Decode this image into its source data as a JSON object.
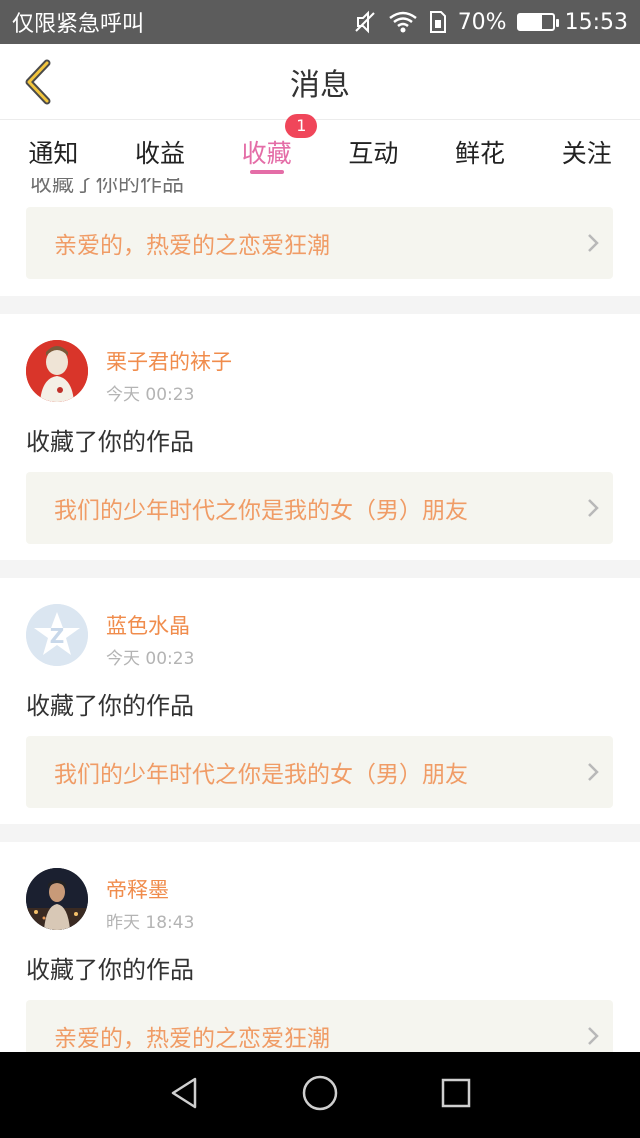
{
  "statusbar": {
    "carrier": "仅限紧急呼叫",
    "battery_percent": "70%",
    "battery_level": 0.7,
    "time": "15:53",
    "icons": [
      "mute-icon",
      "wifi-icon",
      "sim-icon",
      "battery-icon"
    ]
  },
  "header": {
    "title": "消息",
    "back_icon": "chevron-left-icon"
  },
  "tabs": [
    {
      "label": "通知"
    },
    {
      "label": "收益"
    },
    {
      "label": "收藏",
      "badge": "1",
      "active": true
    },
    {
      "label": "互动"
    },
    {
      "label": "鲜花"
    },
    {
      "label": "关注"
    }
  ],
  "feed": {
    "partial_top": {
      "text": "收藏了你的作品",
      "work": "亲爱的，热爱的之恋爱狂潮"
    },
    "items": [
      {
        "name": "栗子君的袜子",
        "time": "今天 00:23",
        "action": "收藏了你的作品",
        "work": "我们的少年时代之你是我的女（男）朋友"
      },
      {
        "name": "蓝色水晶",
        "time": "今天 00:23",
        "action": "收藏了你的作品",
        "work": "我们的少年时代之你是我的女（男）朋友"
      },
      {
        "name": "帝释墨",
        "time": "昨天 18:43",
        "action": "收藏了你的作品",
        "work": "亲爱的，热爱的之恋爱狂潮"
      }
    ]
  },
  "system_nav": {
    "icons": [
      "back-triangle-icon",
      "home-circle-icon",
      "recents-square-icon"
    ]
  },
  "colors": {
    "accent": "#e46da7",
    "name": "#f08c4c",
    "work": "#f09c66",
    "badge": "#f0465a"
  }
}
